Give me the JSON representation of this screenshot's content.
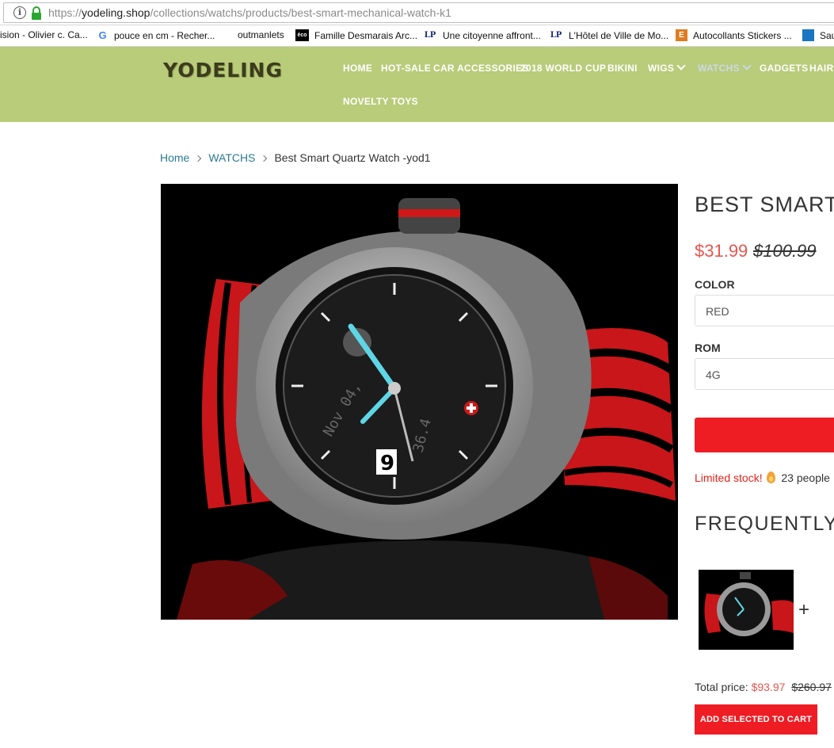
{
  "browser": {
    "url_prefix": "https://",
    "url_domain": "yodeling.shop",
    "url_path": "/collections/watchs/products/best-smart-mechanical-watch-k1"
  },
  "bookmarks": [
    {
      "label": "ision - Olivier c. Ca...",
      "icon": "none"
    },
    {
      "label": "pouce en cm - Recher...",
      "icon": "google-icon"
    },
    {
      "label": "outmanlets",
      "icon": "none"
    },
    {
      "label": "Famille Desmarais Arc...",
      "icon": "eco-icon"
    },
    {
      "label": "Une citoyenne affront...",
      "icon": "lp-icon"
    },
    {
      "label": "L'Hôtel de Ville de Mo...",
      "icon": "lp-icon"
    },
    {
      "label": "Autocollants Stickers ...",
      "icon": "e-icon"
    },
    {
      "label": "Sau",
      "icon": "blue-square-icon"
    }
  ],
  "site": {
    "logo": "YODELING",
    "nav": [
      "HOME",
      "HOT-SALE",
      "CAR ACCESSORIES",
      "2018 WORLD CUP",
      "BIKINI",
      "WIGS",
      "WATCHS",
      "GADGETS",
      "HAIR",
      "NOVELTY TOYS"
    ],
    "active_nav": "WATCHS",
    "header_color": "#b8cc7a"
  },
  "breadcrumb": {
    "home": "Home",
    "collection": "WATCHS",
    "current": "Best Smart Quartz Watch -yod1"
  },
  "product": {
    "title": "BEST SMART",
    "price": "$31.99",
    "compare_price": "$100.99",
    "options": [
      {
        "label": "COLOR",
        "value": "RED"
      },
      {
        "label": "ROM",
        "value": "4G"
      }
    ],
    "stock_red": "Limited stock!",
    "stock_text": "23 people",
    "image_alt": "black and silver smart watch with red strap"
  },
  "bundle": {
    "title": "FREQUENTLY E",
    "plus": "+",
    "total_label": "Total price:",
    "total_sale": "$93.97",
    "total_old": "$260.97",
    "button": "ADD SELECTED TO CART"
  },
  "colors": {
    "accent_red": "#ee1d24",
    "price_red": "#e8554e",
    "link": "#2a7b92"
  }
}
